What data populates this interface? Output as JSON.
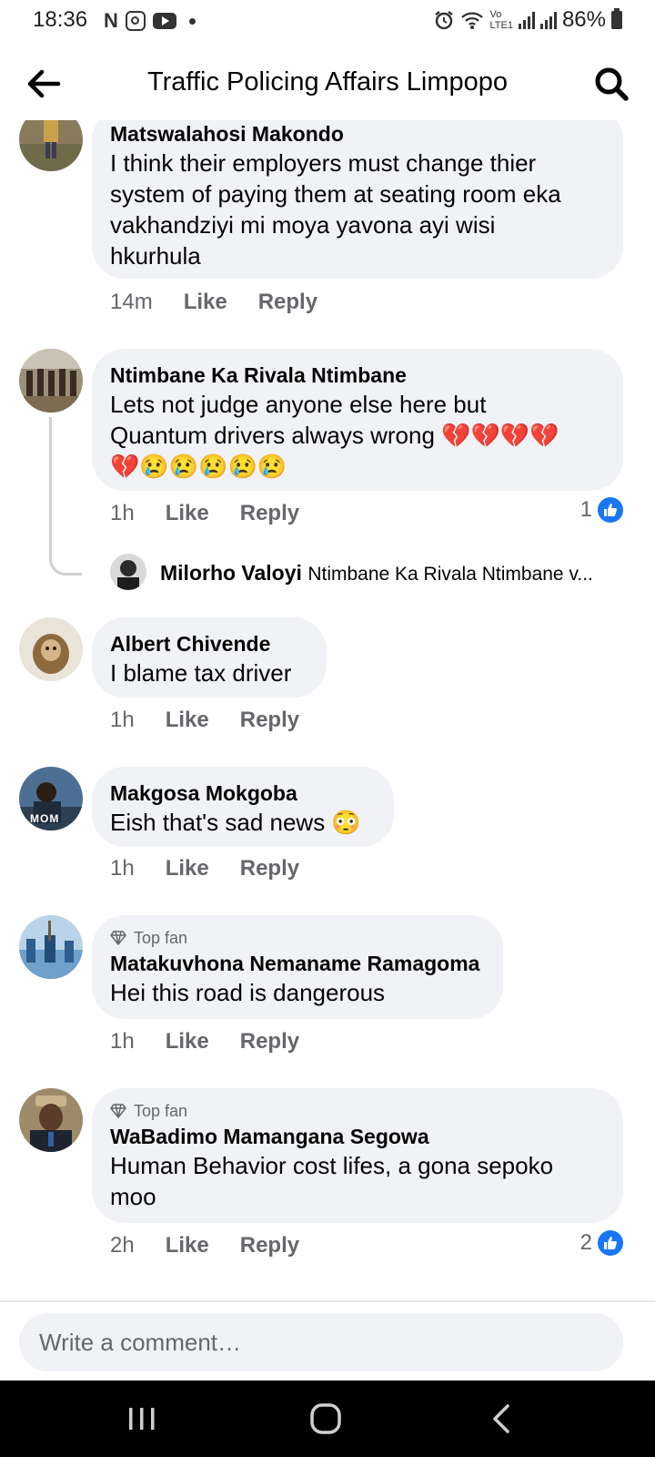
{
  "status_bar": {
    "time": "18:36",
    "network_label": "Vo\nLTE1",
    "battery": "86%"
  },
  "header": {
    "title": "Traffic Policing Affairs Limpopo"
  },
  "comments": [
    {
      "name": "Matswalahosi Makondo",
      "lines": [
        "I think their employers must change thier",
        "system of paying them at seating room eka",
        "vakhandziyi mi moya yavona ayi wisi",
        "hkurhula"
      ],
      "time": "14m",
      "like": "Like",
      "reply": "Reply"
    },
    {
      "name": "Ntimbane Ka Rivala Ntimbane",
      "lines": [
        "Lets not judge anyone else here but",
        "Quantum drivers always wrong 💔💔💔💔",
        "💔😢😢😢😢😢"
      ],
      "time": "1h",
      "like": "Like",
      "reply": "Reply",
      "reaction_count": "1",
      "reply_preview": {
        "name": "Milorho Valoyi",
        "text": "Ntimbane Ka Rivala Ntimbane v..."
      }
    },
    {
      "name": "Albert Chivende",
      "lines": [
        "I blame tax driver"
      ],
      "time": "1h",
      "like": "Like",
      "reply": "Reply"
    },
    {
      "name": "Makgosa Mokgoba",
      "lines": [
        "Eish that's sad news 😳"
      ],
      "time": "1h",
      "like": "Like",
      "reply": "Reply",
      "avatar_label": "MOM"
    },
    {
      "badge": "Top fan",
      "name": "Matakuvhona Nemaname Ramagoma",
      "lines": [
        "Hei this road is dangerous"
      ],
      "time": "1h",
      "like": "Like",
      "reply": "Reply"
    },
    {
      "badge": "Top fan",
      "name": "WaBadimo Mamangana Segowa",
      "lines": [
        "Human Behavior cost lifes,  a gona sepoko",
        "moo"
      ],
      "time": "2h",
      "like": "Like",
      "reply": "Reply",
      "reaction_count": "2"
    }
  ],
  "comment_input": {
    "placeholder": "Write a comment…"
  },
  "colors": {
    "bubble": "#f0f2f5",
    "secondary_text": "#65676b",
    "like_blue": "#1877f2"
  }
}
